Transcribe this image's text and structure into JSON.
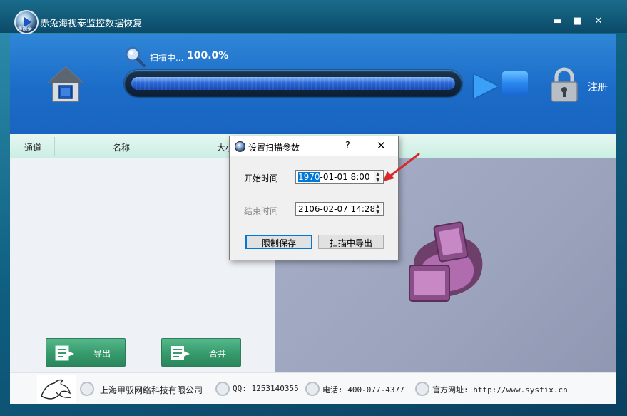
{
  "window": {
    "title": "赤兔海视泰监控数据恢复",
    "logo_text": "海视泰",
    "minimize": "▬",
    "maximize": "■",
    "close": "✕"
  },
  "header": {
    "scan_label": "扫描中...",
    "scan_percent": "100.0%",
    "progress": 1.0,
    "register_label": "注册"
  },
  "columns": [
    "通道",
    "名称",
    "大小"
  ],
  "buttons": {
    "export": "导出",
    "merge": "合并"
  },
  "footer": {
    "company": "上海甲驭网络科技有限公司",
    "qq": "QQ: 1253140355",
    "phone": "电话: 400-077-4377",
    "website": "官方网址: http://www.sysfix.cn"
  },
  "dialog": {
    "title": "设置扫描参数",
    "help": "?",
    "close": "✕",
    "start_label": "开始时间",
    "start_value_selected": "1970",
    "start_value_rest": "-01-01 8:00",
    "end_label": "结束时间",
    "end_value": "2106-02-07 14:28",
    "limit_save_button": "限制保存",
    "export_during_scan_button": "扫描中导出"
  },
  "colors": {
    "header_blue": "#1b6cc8",
    "button_green": "#369a6c",
    "selection": "#0078d7",
    "arrow_red": "#d42a2a"
  }
}
